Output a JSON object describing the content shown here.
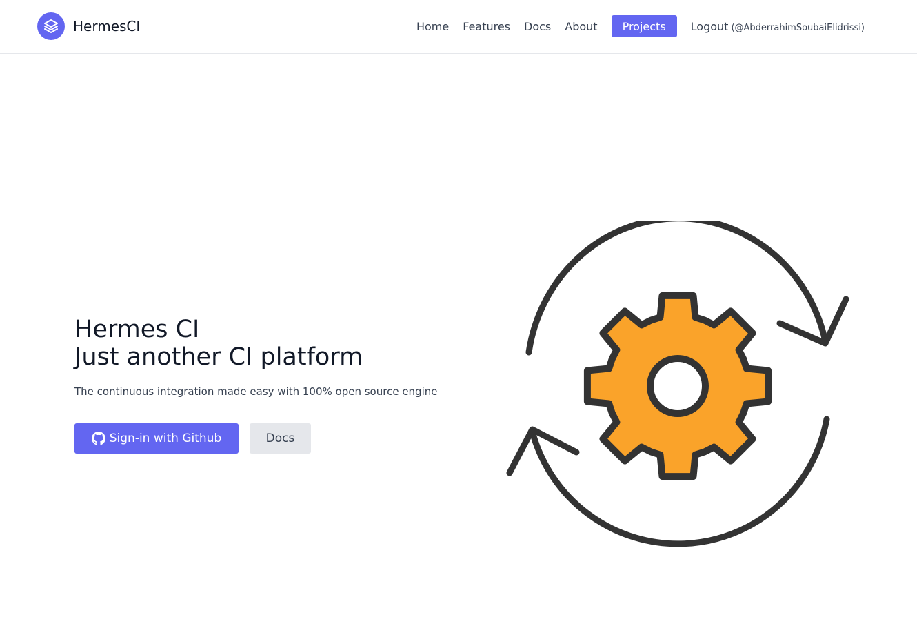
{
  "header": {
    "brand_name": "HermesCI",
    "logo_icon": "layers-icon",
    "nav": {
      "home": "Home",
      "features": "Features",
      "docs": "Docs",
      "about": "About",
      "projects": "Projects",
      "logout": "Logout",
      "username": "(@AbderrahimSoubaiElidrissi)"
    }
  },
  "hero": {
    "title_line1": "Hermes CI",
    "title_line2": "Just another CI platform",
    "subtitle": "The continuous integration made easy with 100% open source engine",
    "signin_label": "Sign-in with Github",
    "signin_icon": "github-icon",
    "docs_label": "Docs"
  },
  "illustration": {
    "icon": "gear-sync-icon"
  },
  "colors": {
    "accent": "#6366f1",
    "gear": "#faa32a",
    "outline": "#333333",
    "secondary_button": "#e5e7eb"
  }
}
